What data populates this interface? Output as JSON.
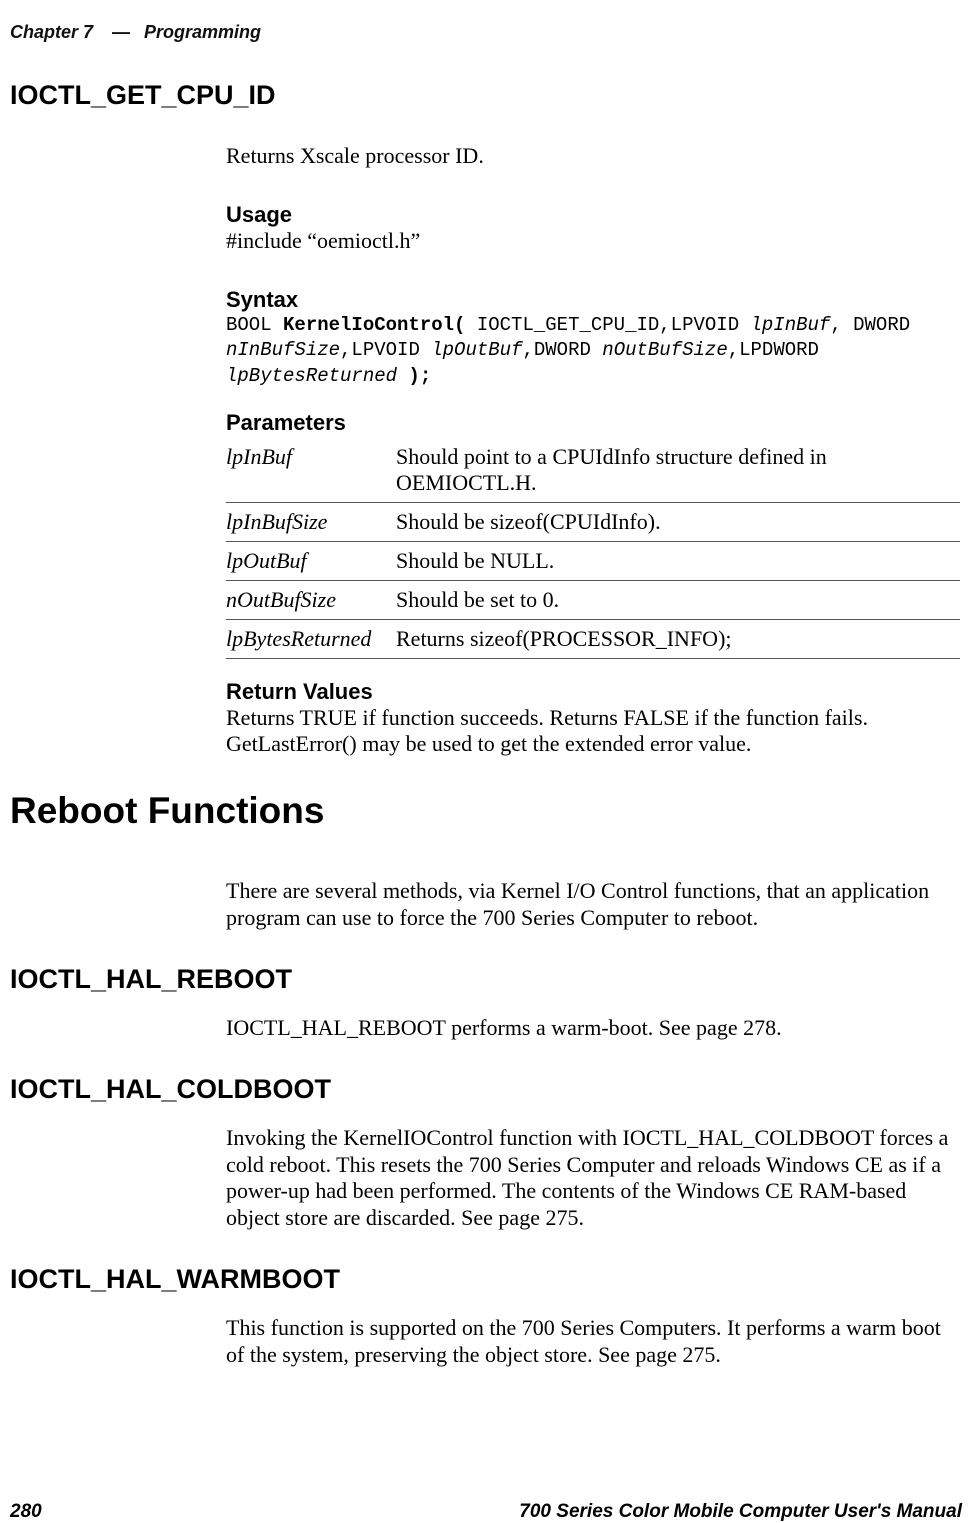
{
  "header": {
    "chapter": "Chapter 7",
    "dash": "—",
    "section": "Programming"
  },
  "footer": {
    "page": "280",
    "manual": "700 Series Color Mobile Computer User's Manual"
  },
  "s1": {
    "title": "IOCTL_GET_CPU_ID",
    "intro": "Returns Xscale processor ID.",
    "usage_h": "Usage",
    "usage_t": "#include “oemioctl.h”",
    "syntax_h": "Syntax",
    "syntax": {
      "l1a": "BOOL ",
      "l1b": "KernelIoControl(",
      "l1c": " IOCTL_GET_CPU_ID,LPVOID ",
      "l1d": "lpInBuf",
      "l1e": ", DWORD",
      "l2a": "nInBufSize",
      "l2b": ",LPVOID ",
      "l2c": "lpOutBuf",
      "l2d": ",DWORD ",
      "l2e": "nOutBufSize",
      "l2f": ",LPDWORD",
      "l3a": "lpBytesReturned",
      "l3b": " );"
    },
    "params_h": "Parameters",
    "params": {
      "r1n": "lpInBuf",
      "r1d": "Should point to a CPUIdInfo structure defined in OEMIOCTL.H.",
      "r2n": "lpInBufSize",
      "r2d": "Should be sizeof(CPUIdInfo).",
      "r3n": "lpOutBuf",
      "r3d": "Should be NULL.",
      "r4n": "nOutBufSize",
      "r4d": "Should be set to 0.",
      "r5n": "lpBytesReturned",
      "r5d": "Returns sizeof(PROCESSOR_INFO);"
    },
    "ret_h": "Return Values",
    "ret_t": "Returns TRUE if function succeeds. Returns FALSE if the function fails. GetLastError() may be used to get the extended error value."
  },
  "s2": {
    "title": "Reboot Functions",
    "intro": "There are several methods, via Kernel I/O Control functions, that an application program can use to force the 700 Series Computer to reboot."
  },
  "s3": {
    "title": "IOCTL_HAL_REBOOT",
    "text": "IOCTL_HAL_REBOOT performs a warm-boot. See page 278."
  },
  "s4": {
    "title": "IOCTL_HAL_COLDBOOT",
    "text": "Invoking the KernelIOControl function with IOCTL_HAL_COLDBOOT forces a cold reboot. This resets the 700 Series Computer and reloads Windows CE as if a power-up had been performed. The contents of the Windows CE RAM-based object store are discarded. See page 275."
  },
  "s5": {
    "title": "IOCTL_HAL_WARMBOOT",
    "text": "This function is supported on the 700 Series Computers. It performs a warm boot of the system, preserving the object store. See page 275."
  }
}
